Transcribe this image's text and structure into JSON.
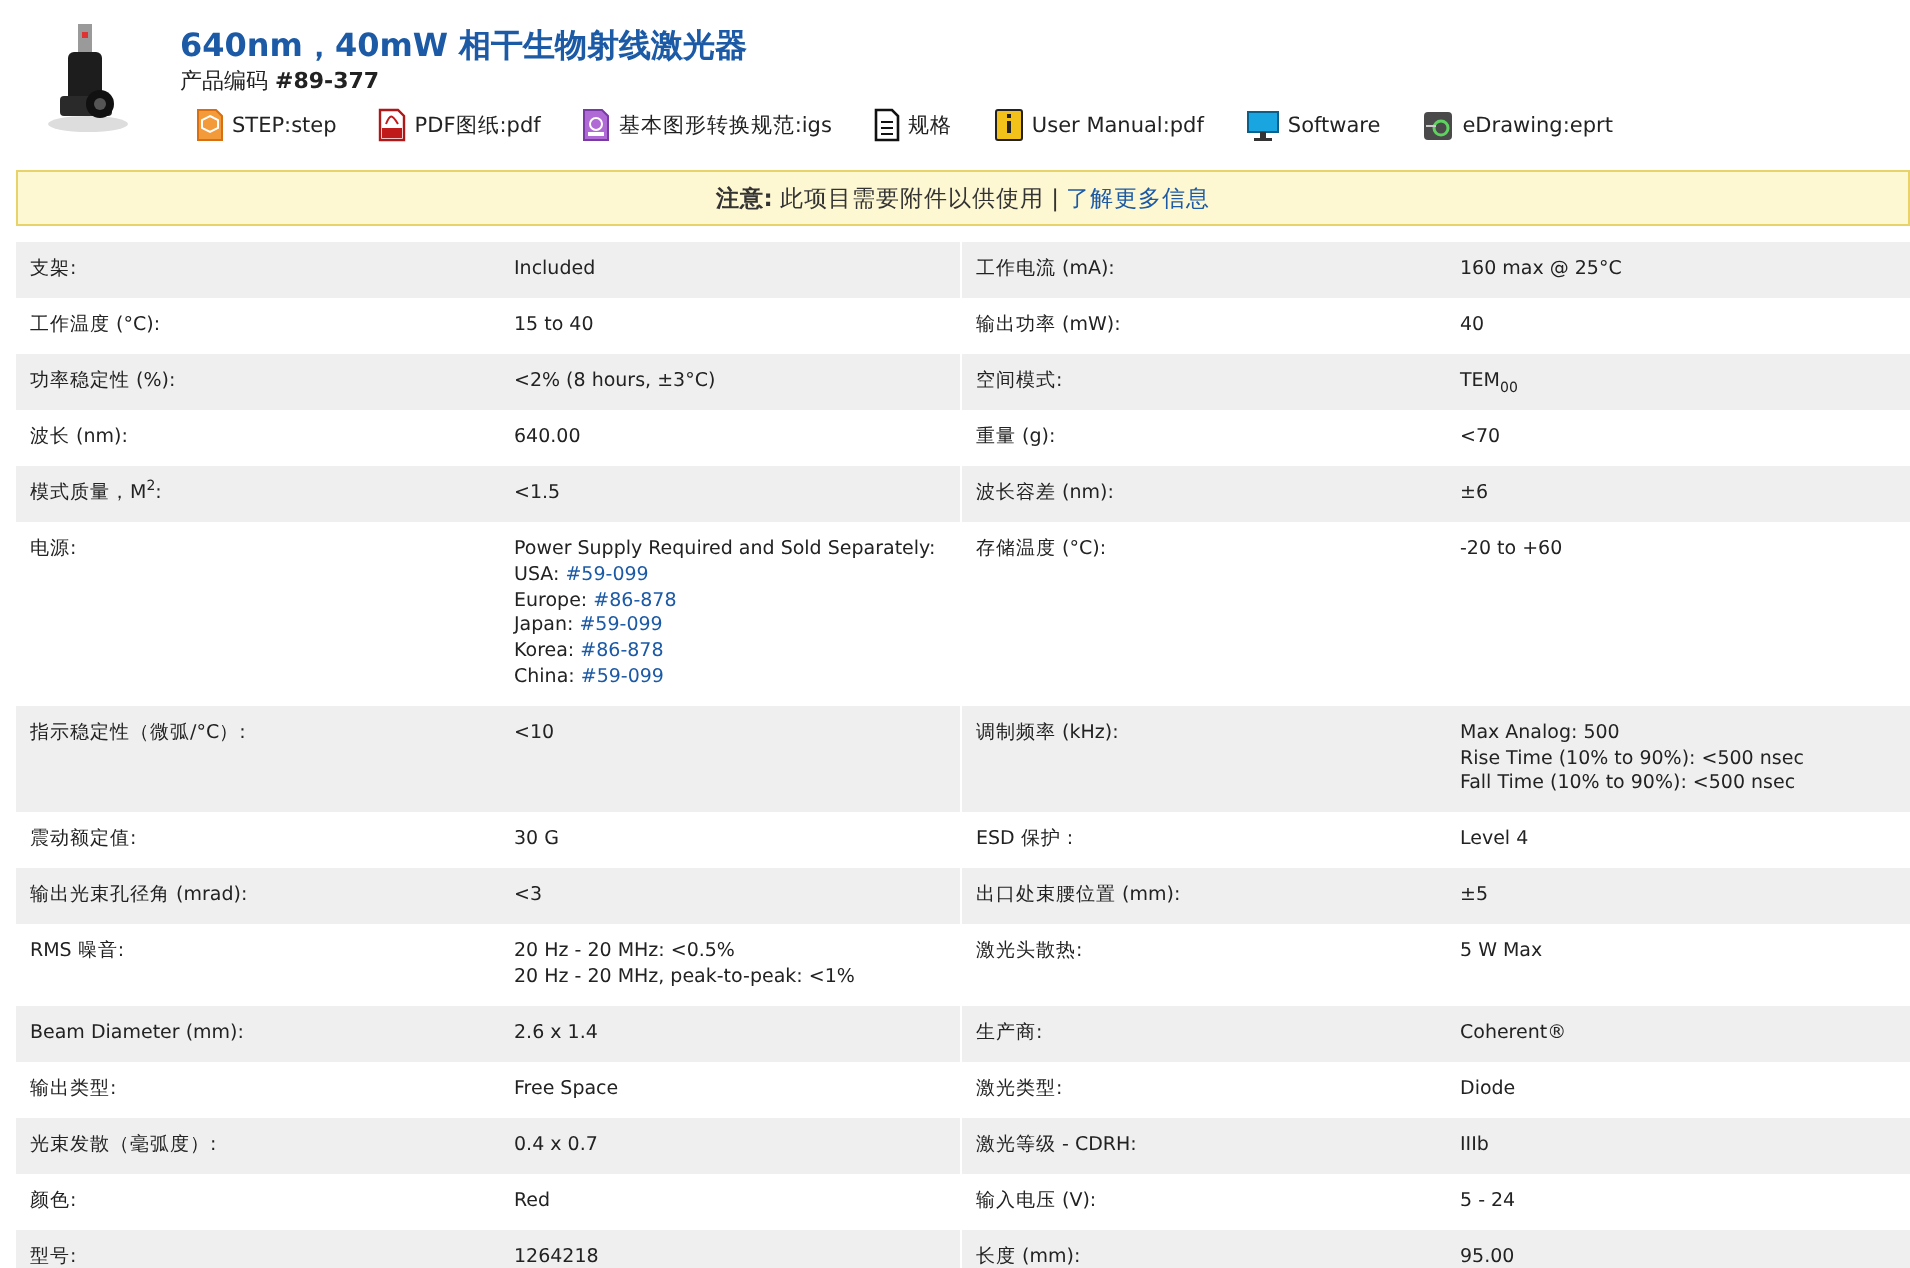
{
  "header": {
    "title": "640nm，40mW 相干生物射线激光器",
    "code_label": "产品编码",
    "code": "#89-377",
    "attachments": [
      {
        "kind": "step",
        "label": "STEP:step"
      },
      {
        "kind": "pdf",
        "label": "PDF图纸:pdf"
      },
      {
        "kind": "igs",
        "label": "基本图形转换规范:igs"
      },
      {
        "kind": "spec",
        "label": "规格"
      },
      {
        "kind": "manual",
        "label": "User Manual:pdf"
      },
      {
        "kind": "software",
        "label": "Software"
      },
      {
        "kind": "edrawing",
        "label": "eDrawing:eprt"
      }
    ]
  },
  "notice": {
    "text": "**注意:** 此项目需要附件以供使用 | ",
    "link": "了解更多信息"
  },
  "specs": [
    {
      "left": {
        "label": "支架:",
        "lines": [
          {
            "text": "Included"
          }
        ]
      },
      "right": {
        "label": "工作电流 (mA):",
        "lines": [
          {
            "text": "160 max @ 25°C"
          }
        ]
      }
    },
    {
      "left": {
        "label": "工作温度 (°C):",
        "lines": [
          {
            "text": "15 to 40"
          }
        ]
      },
      "right": {
        "label": "输出功率 (mW):",
        "lines": [
          {
            "text": "40"
          }
        ]
      }
    },
    {
      "left": {
        "label": "功率稳定性 (%):",
        "lines": [
          {
            "text": "<2% (8 hours, ±3°C)"
          }
        ]
      },
      "right": {
        "label": "空间模式:",
        "lines": [
          {
            "text": "TEM$_{00}$"
          }
        ]
      }
    },
    {
      "left": {
        "label": "波长 (nm):",
        "lines": [
          {
            "text": "640.00"
          }
        ]
      },
      "right": {
        "label": "重量 (g):",
        "lines": [
          {
            "text": "<70"
          }
        ]
      }
    },
    {
      "left": {
        "label": "模式质量，M$^{2}$:",
        "lines": [
          {
            "text": "<1.5"
          }
        ]
      },
      "right": {
        "label": "波长容差 (nm):",
        "lines": [
          {
            "text": "±6"
          }
        ]
      }
    },
    {
      "left": {
        "label": "电源:",
        "lines": [
          {
            "text": "Power Supply Required and Sold Separately:"
          },
          {
            "text": "USA: ",
            "link": "#59-099"
          },
          {
            "text": "Europe: ",
            "link": "#86-878"
          },
          {
            "text": "Japan: ",
            "link": "#59-099"
          },
          {
            "text": "Korea: ",
            "link": "#86-878"
          },
          {
            "text": "China: ",
            "link": "#59-099"
          }
        ]
      },
      "right": {
        "label": "存储温度 (°C):",
        "lines": [
          {
            "text": "-20 to +60"
          }
        ]
      }
    },
    {
      "left": {
        "label": "指示稳定性（微弧/°C）:",
        "lines": [
          {
            "text": "<10"
          }
        ]
      },
      "right": {
        "label": "调制频率 (kHz):",
        "lines": [
          {
            "text": "Max Analog: 500"
          },
          {
            "text": "Rise Time (10% to 90%): <500 nsec"
          },
          {
            "text": "Fall Time (10% to 90%): <500 nsec"
          }
        ]
      }
    },
    {
      "left": {
        "label": "震动额定值:",
        "lines": [
          {
            "text": "30 G"
          }
        ]
      },
      "right": {
        "label": "ESD 保护 :",
        "lines": [
          {
            "text": "Level 4"
          }
        ]
      }
    },
    {
      "left": {
        "label": "输出光束孔径角 (mrad):",
        "lines": [
          {
            "text": "<3"
          }
        ]
      },
      "right": {
        "label": "出口处束腰位置 (mm):",
        "lines": [
          {
            "text": "±5"
          }
        ]
      }
    },
    {
      "left": {
        "label": "RMS 噪音:",
        "lines": [
          {
            "text": "20 Hz - 20 MHz: <0.5%"
          },
          {
            "text": "20 Hz - 20 MHz, peak-to-peak: <1%"
          }
        ]
      },
      "right": {
        "label": "激光头散热:",
        "lines": [
          {
            "text": "5 W Max"
          }
        ]
      }
    },
    {
      "left": {
        "label": "Beam Diameter (mm):",
        "lines": [
          {
            "text": "2.6 x 1.4"
          }
        ]
      },
      "right": {
        "label": "生产商:",
        "lines": [
          {
            "text": "Coherent®"
          }
        ]
      }
    },
    {
      "left": {
        "label": "输出类型:",
        "lines": [
          {
            "text": "Free Space"
          }
        ]
      },
      "right": {
        "label": "激光类型:",
        "lines": [
          {
            "text": "Diode"
          }
        ]
      }
    },
    {
      "left": {
        "label": "光束发散（毫弧度）:",
        "lines": [
          {
            "text": "0.4 x 0.7"
          }
        ]
      },
      "right": {
        "label": "激光等级 - CDRH:",
        "lines": [
          {
            "text": "IIIb"
          }
        ]
      }
    },
    {
      "left": {
        "label": "颜色:",
        "lines": [
          {
            "text": "Red"
          }
        ]
      },
      "right": {
        "label": "输入电压 (V):",
        "lines": [
          {
            "text": "5 - 24"
          }
        ]
      }
    },
    {
      "left": {
        "label": "型号:",
        "lines": [
          {
            "text": "1264218"
          }
        ]
      },
      "right": {
        "label": "长度 (mm):",
        "lines": [
          {
            "text": "95.00"
          }
        ]
      }
    }
  ]
}
